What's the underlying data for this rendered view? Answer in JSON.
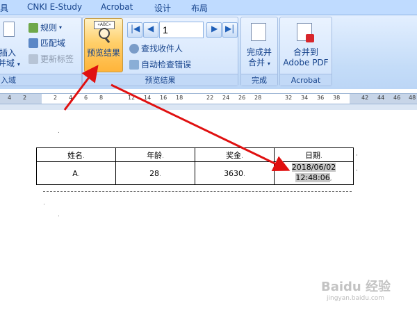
{
  "menu": {
    "tabs": [
      "具",
      "CNKI E-Study",
      "Acrobat",
      "设计",
      "布局"
    ]
  },
  "ribbon": {
    "insert_group": {
      "insert_label": "插入",
      "merge_field_label": "并域",
      "group_label": "入域"
    },
    "rules_label": "规则",
    "match_field_label": "匹配域",
    "update_labels_label": "更新标签",
    "preview_group": {
      "preview_button_label": "预览结果",
      "preview_icon_text": "«ABC»",
      "record_number": "1",
      "find_recipient_label": "查找收件人",
      "auto_check_label": "自动检查错误",
      "group_label": "预览结果"
    },
    "finish_group": {
      "finish_line1": "完成并",
      "finish_line2": "合并",
      "group_label": "完成"
    },
    "acrobat_group": {
      "merge_line1": "合并到",
      "merge_line2": "Adobe PDF",
      "group_label": "Acrobat"
    }
  },
  "ruler": {
    "numbers": [
      "4",
      "2",
      "2",
      "4",
      "6",
      "8",
      "12",
      "14",
      "16",
      "18",
      "22",
      "24",
      "26",
      "28",
      "32",
      "34",
      "36",
      "38",
      "42",
      "44",
      "46",
      "48"
    ]
  },
  "document": {
    "table": {
      "headers": [
        "姓名",
        "年龄",
        "奖金",
        "日期"
      ],
      "row": {
        "name": "A",
        "age": "28",
        "bonus": "3630",
        "date_line1": "2018/06/02",
        "date_line2": "12:48:06"
      }
    },
    "para_mark": ".",
    "cell_mark": ".",
    "cell_end_mark": ","
  },
  "watermark": {
    "brand": "Baidu 经验",
    "url": "jingyan.baidu.com"
  },
  "colors": {
    "ribbon_text": "#15428b",
    "tab_bar": "#bfdbff",
    "arrow": "#e01010",
    "preview_highlight": "#ffcf6a"
  }
}
